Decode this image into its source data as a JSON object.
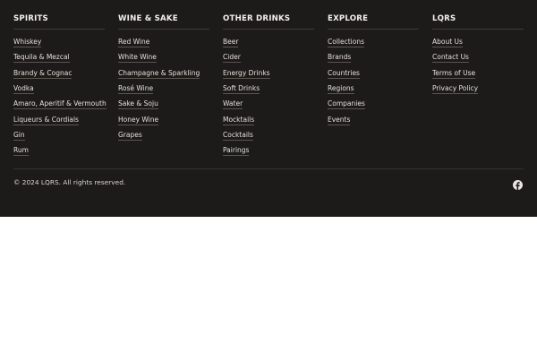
{
  "footer": {
    "columns": [
      {
        "title": "SPIRITS",
        "links": [
          "Whiskey",
          "Tequila & Mezcal",
          "Brandy & Cognac",
          "Vodka",
          "Amaro, Aperitif & Vermouth",
          "Liqueurs & Cordials",
          "Gin",
          "Rum"
        ]
      },
      {
        "title": "WINE & SAKE",
        "links": [
          "Red Wine",
          "White Wine",
          "Champagne & Sparkling",
          "Rosé Wine",
          "Sake & Soju",
          "Honey Wine",
          "Grapes"
        ]
      },
      {
        "title": "OTHER DRINKS",
        "links": [
          "Beer",
          "Cider",
          "Energy Drinks",
          "Soft Drinks",
          "Water",
          "Mocktails",
          "Cocktails",
          "Pairings"
        ]
      },
      {
        "title": "EXPLORE",
        "links": [
          "Collections",
          "Brands",
          "Countries",
          "Regions",
          "Companies",
          "Events"
        ]
      },
      {
        "title": "LQRS",
        "links": [
          "About Us",
          "Contact Us",
          "Terms of Use",
          "Privacy Policy"
        ]
      }
    ],
    "copyright": "© 2024 LQRS. All rights reserved.",
    "social_icon": "facebook-icon",
    "colors": {
      "background": "#1d1b1a",
      "text": "#e9e6e2",
      "divider": "#35322f"
    }
  }
}
